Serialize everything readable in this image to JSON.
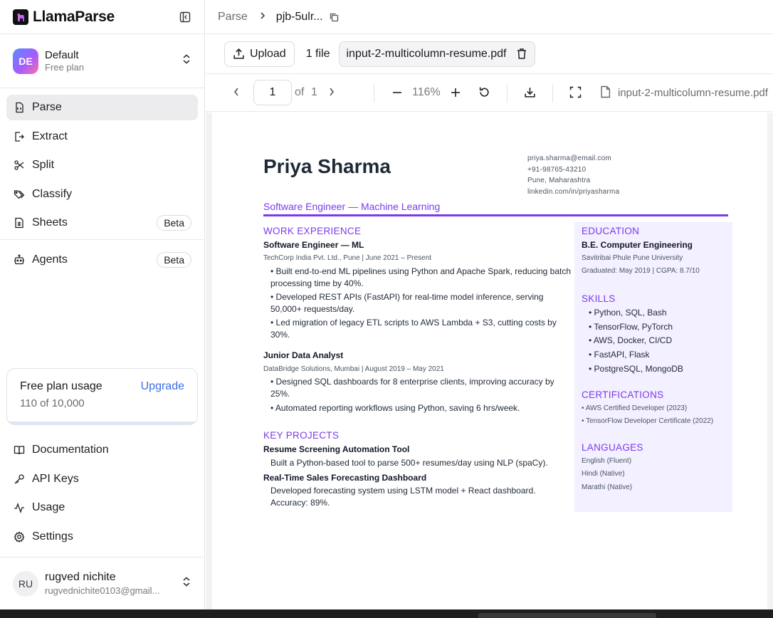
{
  "brand": {
    "name": "LlamaParse"
  },
  "workspace": {
    "initials": "DE",
    "name": "Default",
    "plan": "Free plan"
  },
  "nav": {
    "items": [
      {
        "label": "Parse",
        "icon": "parse-icon"
      },
      {
        "label": "Extract",
        "icon": "extract-icon"
      },
      {
        "label": "Split",
        "icon": "scissors-icon"
      },
      {
        "label": "Classify",
        "icon": "tags-icon"
      },
      {
        "label": "Sheets",
        "icon": "sheet-icon",
        "badge": "Beta"
      }
    ],
    "agents": {
      "label": "Agents",
      "icon": "bot-icon",
      "badge": "Beta"
    }
  },
  "usage": {
    "title": "Free plan usage",
    "upgrade": "Upgrade",
    "count": "110 of 10,000",
    "fraction": 0.011
  },
  "bottom_nav": [
    {
      "label": "Documentation",
      "icon": "book-icon"
    },
    {
      "label": "API Keys",
      "icon": "key-icon"
    },
    {
      "label": "Usage",
      "icon": "activity-icon"
    },
    {
      "label": "Settings",
      "icon": "gear-icon"
    }
  ],
  "user": {
    "initials": "RU",
    "name": "rugved nichite",
    "email": "rugvednichite0103@gmail..."
  },
  "breadcrumb": {
    "parent": "Parse",
    "job": "pjb-5ulr..."
  },
  "file_bar": {
    "upload_label": "Upload",
    "file_count": "1 file",
    "file_name": "input-2-multicolumn-resume.pdf"
  },
  "viewer": {
    "page": "1",
    "of_label": "of",
    "total_pages": "1",
    "zoom": "116%",
    "file_name": "input-2-multicolumn-resume.pdf"
  },
  "resume": {
    "name": "Priya Sharma",
    "contact": [
      "priya.sharma@email.com",
      "+91-98765-43210",
      "Pune, Maharashtra",
      "linkedin.com/in/priyasharma"
    ],
    "role": "Software Engineer — Machine Learning",
    "work_heading": "WORK EXPERIENCE",
    "jobs": [
      {
        "title": "Software Engineer — ML",
        "meta": "TechCorp India Pvt. Ltd., Pune | June 2021 – Present",
        "bullets": [
          "• Built end-to-end ML pipelines using Python and Apache Spark, reducing batch",
          "processing time by 40%.",
          "• Developed REST APIs (FastAPI) for real-time model inference, serving",
          "50,000+ requests/day.",
          "• Led migration of legacy ETL scripts to AWS Lambda + S3, cutting costs by",
          "30%."
        ]
      },
      {
        "title": "Junior Data Analyst",
        "meta": "DataBridge Solutions, Mumbai | August 2019 – May 2021",
        "bullets": [
          "• Designed SQL dashboards for 8 enterprise clients, improving accuracy by",
          "25%.",
          "• Automated reporting workflows using Python, saving 6 hrs/week."
        ]
      }
    ],
    "projects_heading": "KEY PROJECTS",
    "projects": [
      {
        "title": "Resume Screening Automation Tool",
        "lines": [
          "Built a Python-based tool to parse 500+ resumes/day using NLP (spaCy)."
        ]
      },
      {
        "title": "Real-Time Sales Forecasting Dashboard",
        "lines": [
          "Developed forecasting system using LSTM model + React dashboard.",
          "Accuracy: 89%."
        ]
      }
    ],
    "education_heading": "EDUCATION",
    "degree": "B.E. Computer Engineering",
    "university": "Savitribai Phule Pune University",
    "graduated": "Graduated: May 2019 | CGPA: 8.7/10",
    "skills_heading": "SKILLS",
    "skills": [
      "• Python, SQL, Bash",
      "• TensorFlow, PyTorch",
      "• AWS, Docker, CI/CD",
      "• FastAPI, Flask",
      "• PostgreSQL, MongoDB"
    ],
    "certs_heading": "CERTIFICATIONS",
    "certs": [
      "• AWS Certified Developer (2023)",
      "• TensorFlow Developer Certificate (2022)"
    ],
    "languages_heading": "LANGUAGES",
    "languages": [
      "English (Fluent)",
      "Hindi (Native)",
      "Marathi (Native)"
    ]
  },
  "colors": {
    "accent": "#7c3aed",
    "link": "#3b6fe0",
    "active_nav_bg": "#ececef",
    "sidebar_panel_bg": "#f3f0ff"
  }
}
